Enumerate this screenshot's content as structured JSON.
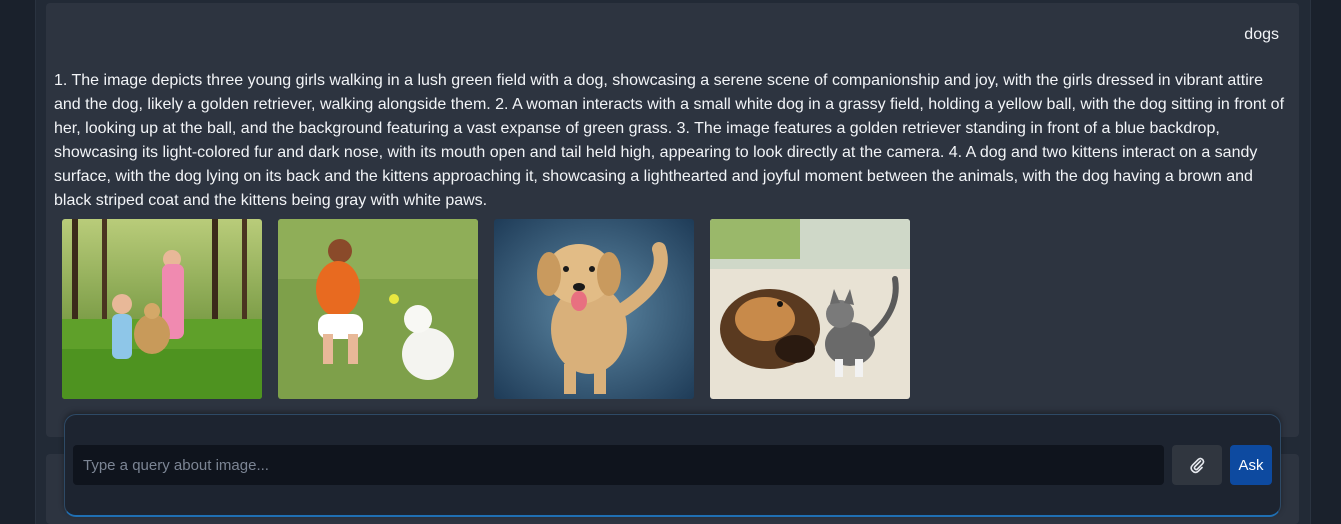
{
  "conversation": {
    "user_query": "dogs",
    "answer": "1. The image depicts three young girls walking in a lush green field with a dog, showcasing a serene scene of companionship and joy, with the girls dressed in vibrant attire and the dog, likely a golden retriever, walking alongside them. 2. A woman interacts with a small white dog in a grassy field, holding a yellow ball, with the dog sitting in front of her, looking up at the ball, and the background featuring a vast expanse of green grass. 3. The image features a golden retriever standing in front of a blue backdrop, showcasing its light-colored fur and dark nose, with its mouth open and tail held high, appearing to look directly at the camera. 4. A dog and two kittens interact on a sandy surface, with the dog lying on its back and the kittens approaching it, showcasing a lighthearted and joyful moment between the animals, with the dog having a brown and black striped coat and the kittens being gray with white paws.",
    "images": [
      {
        "icon": "girls-with-dog-photo"
      },
      {
        "icon": "woman-with-white-dog-photo"
      },
      {
        "icon": "golden-retriever-photo"
      },
      {
        "icon": "dog-and-kitten-photo"
      }
    ]
  },
  "composer": {
    "placeholder": "Type a query about image...",
    "attach_icon": "paperclip-icon",
    "ask_label": "Ask"
  },
  "colors": {
    "background": "#1a212c",
    "card": "#2d3440",
    "accent": "#0d4aa0",
    "composer_border": "#1f6fb3"
  }
}
